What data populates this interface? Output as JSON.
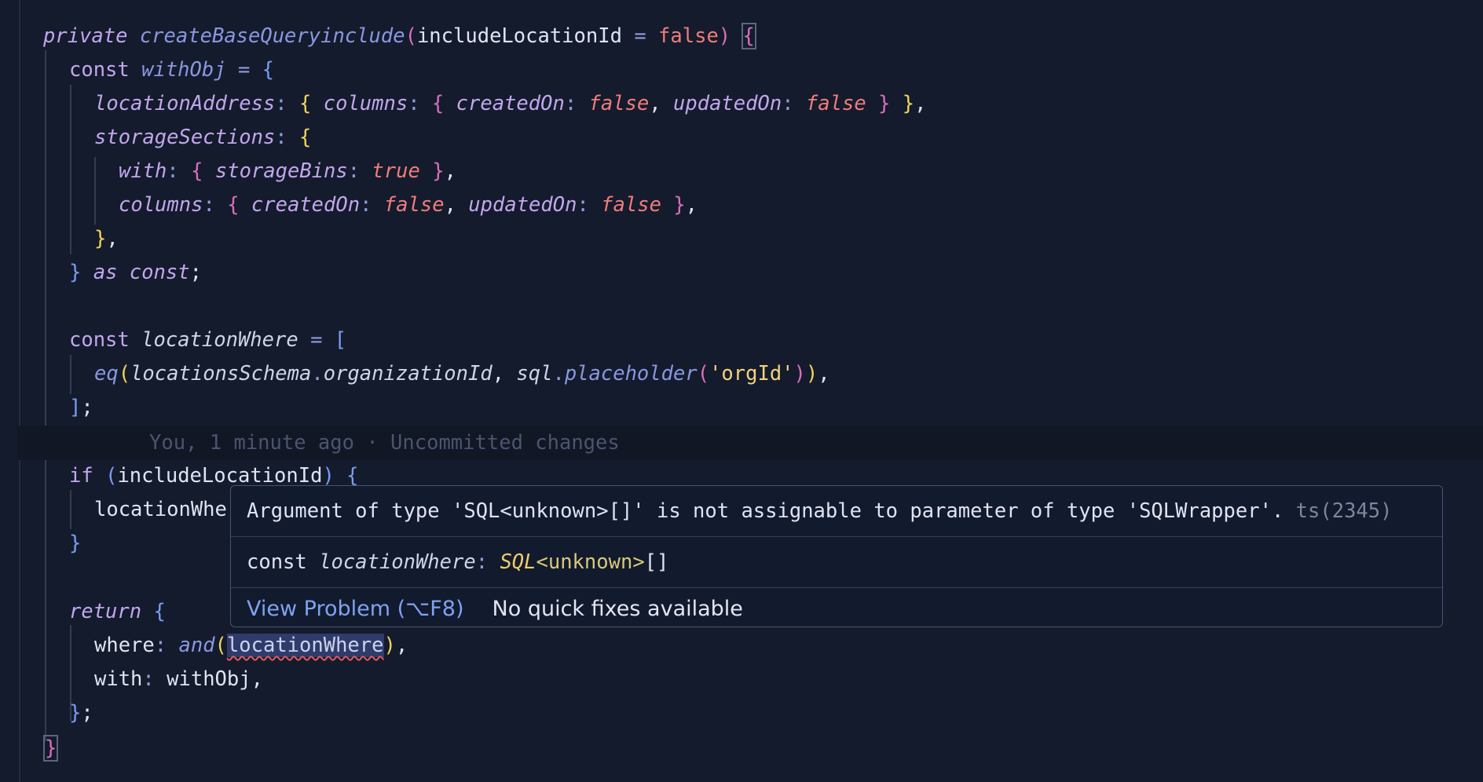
{
  "code": {
    "method_modifier": "private",
    "method_name": "createBaseQueryinclude",
    "param_name": "includeLocationId",
    "param_default": "false",
    "const_kw": "const",
    "with_obj": "withObj",
    "location_address": "locationAddress",
    "columns": "columns",
    "created_on": "createdOn",
    "updated_on": "updatedOn",
    "false_val": "false",
    "true_val": "true",
    "storage_sections": "storageSections",
    "with_kw": "with",
    "storage_bins": "storageBins",
    "as_kw": "as",
    "const_kw2": "const",
    "location_where": "locationWhere",
    "eq_fn": "eq",
    "locations_schema": "locationsSchema",
    "organization_id": "organizationId",
    "sql_obj": "sql",
    "placeholder_fn": "placeholder",
    "org_id_str": "'orgId'",
    "if_kw": "if",
    "location_where_partial": "locationWhe",
    "return_kw": "return",
    "where_key": "where",
    "and_fn": "and",
    "with_key": "with",
    "with_obj_ref": "withObj"
  },
  "blame": {
    "text": "You, 1 minute ago · Uncommitted changes"
  },
  "hover": {
    "message": "Argument of type 'SQL<unknown>[]' is not assignable to parameter of type 'SQLWrapper'.",
    "error_code": "ts(2345)",
    "decl_kw": "const",
    "decl_name": "locationWhere",
    "decl_type": "SQL",
    "decl_generic": "<unknown>",
    "decl_suffix": "[]",
    "view_problem": "View Problem (⌥F8)",
    "no_fixes": "No quick fixes available"
  },
  "colors": {
    "background": "#141b2c",
    "error_underline": "#e05a5a",
    "link": "#7ea3f2"
  }
}
